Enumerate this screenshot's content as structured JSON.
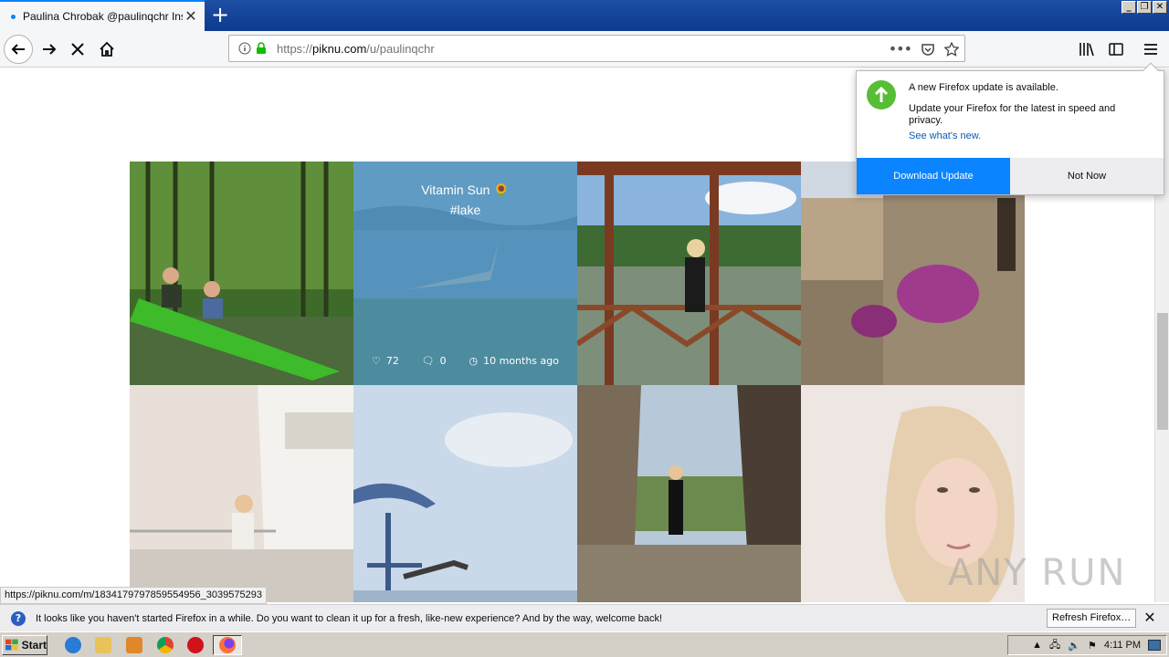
{
  "browser": {
    "tab_title": "Paulina Chrobak @paulinqchr Insta",
    "url_prefix": "https://",
    "url_host": "piknu.com",
    "url_path": "/u/paulinqchr"
  },
  "status_link": "https://piknu.com/m/1834179797859554956_3039575293",
  "update_panel": {
    "heading": "A new Firefox update is available.",
    "body": "Update your Firefox for the latest in speed and privacy.",
    "link": "See what's new.",
    "download_label": "Download Update",
    "not_now_label": "Not Now"
  },
  "grid": {
    "hover_post": {
      "caption_line1": "Vitamin Sun 🌻",
      "caption_line2": "#lake",
      "likes": "72",
      "comments": "0",
      "time": "10 months ago"
    }
  },
  "notification": {
    "message": "It looks like you haven't started Firefox in a while. Do you want to clean it up for a fresh, like-new experience? And by the way, welcome back!",
    "button_label": "Refresh Firefox…"
  },
  "taskbar": {
    "start_label": "Start",
    "clock": "4:11 PM"
  },
  "watermark": "ANY RUN",
  "colors": {
    "accent": "#0a84ff",
    "update_green": "#57bd35",
    "overlay": "#468cb9"
  }
}
